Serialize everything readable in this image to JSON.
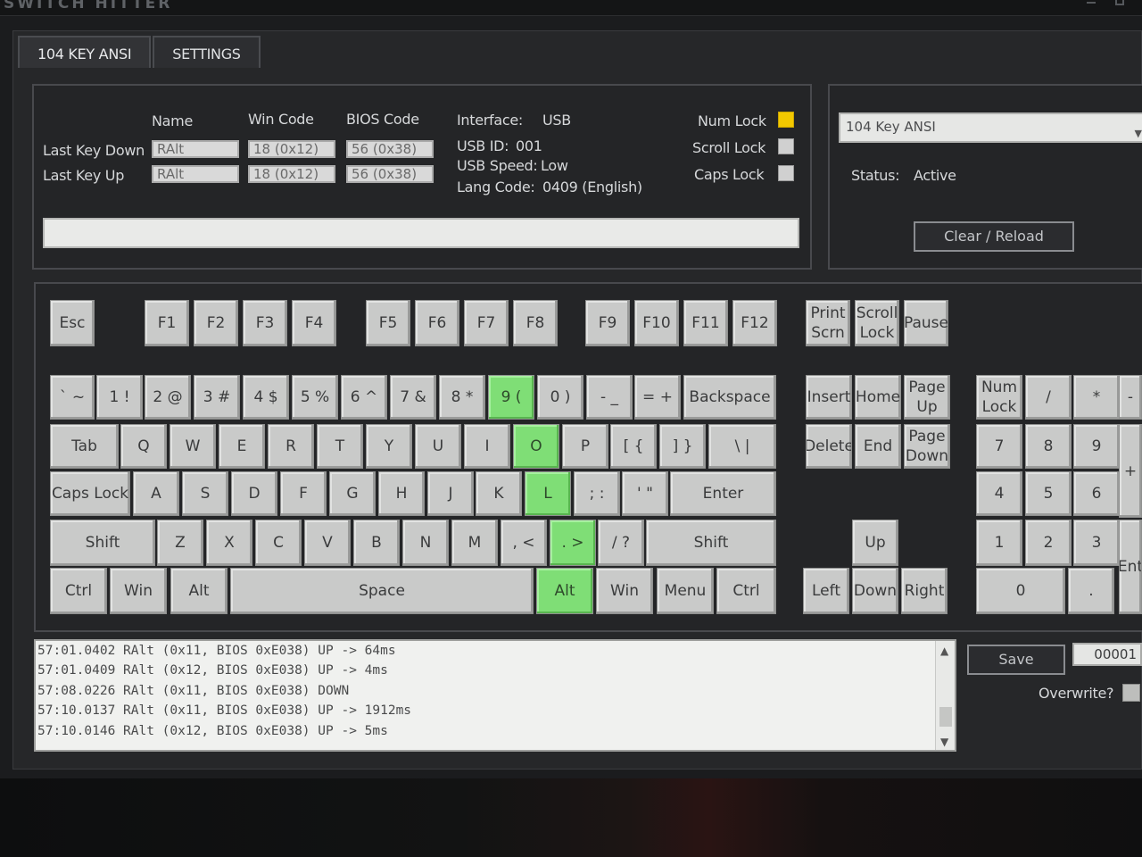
{
  "app": {
    "title": "SWITCH HITTER"
  },
  "tabs": [
    {
      "label": "104 KEY ANSI"
    },
    {
      "label": "SETTINGS"
    }
  ],
  "info": {
    "col_name": "Name",
    "col_win": "Win Code",
    "col_bios": "BIOS Code",
    "last_key_down": {
      "label": "Last Key Down",
      "name": "RAlt",
      "win": "18 (0x12)",
      "bios": "56 (0x38)"
    },
    "last_key_up": {
      "label": "Last Key Up",
      "name": "RAlt",
      "win": "18 (0x12)",
      "bios": "56 (0x38)"
    },
    "interface_label": "Interface:",
    "interface_value": "USB",
    "usb_id_label": "USB ID:",
    "usb_id_value": "001",
    "usb_speed_label": "USB Speed:",
    "usb_speed_value": "Low",
    "lang_label": "Lang Code:",
    "lang_value": "0409 (English)",
    "locks": [
      {
        "label": "Num Lock",
        "on": true
      },
      {
        "label": "Scroll Lock",
        "on": false
      },
      {
        "label": "Caps Lock",
        "on": false
      }
    ],
    "indicator_on_color": "#f2c800"
  },
  "right": {
    "layout_selected": "104 Key ANSI",
    "status_label": "Status:",
    "status_value": "Active",
    "clear_button": "Clear / Reload"
  },
  "keyboard": {
    "pressed_color": "#7fde76",
    "keys": [
      {
        "label": "Esc",
        "pressed": false
      },
      {
        "label": "F1",
        "pressed": false
      },
      {
        "label": "F2",
        "pressed": false
      },
      {
        "label": "F3",
        "pressed": false
      },
      {
        "label": "F4",
        "pressed": false
      },
      {
        "label": "F5",
        "pressed": false
      },
      {
        "label": "F6",
        "pressed": false
      },
      {
        "label": "F7",
        "pressed": false
      },
      {
        "label": "F8",
        "pressed": false
      },
      {
        "label": "F9",
        "pressed": false
      },
      {
        "label": "F10",
        "pressed": false
      },
      {
        "label": "F11",
        "pressed": false
      },
      {
        "label": "F12",
        "pressed": false
      },
      {
        "label": "Print\nScrn",
        "pressed": false
      },
      {
        "label": "Scroll\nLock",
        "pressed": false
      },
      {
        "label": "Pause",
        "pressed": false
      },
      {
        "label": "` ~",
        "pressed": false
      },
      {
        "label": "1 !",
        "pressed": false
      },
      {
        "label": "2 @",
        "pressed": false
      },
      {
        "label": "3 #",
        "pressed": false
      },
      {
        "label": "4 $",
        "pressed": false
      },
      {
        "label": "5 %",
        "pressed": false
      },
      {
        "label": "6 ^",
        "pressed": false
      },
      {
        "label": "7 &",
        "pressed": false
      },
      {
        "label": "8 *",
        "pressed": false
      },
      {
        "label": "9 (",
        "pressed": true
      },
      {
        "label": "0 )",
        "pressed": false
      },
      {
        "label": "- _",
        "pressed": false
      },
      {
        "label": "= +",
        "pressed": false
      },
      {
        "label": "Backspace",
        "pressed": false
      },
      {
        "label": "Insert",
        "pressed": false
      },
      {
        "label": "Home",
        "pressed": false
      },
      {
        "label": "Page\nUp",
        "pressed": false
      },
      {
        "label": "Num\nLock",
        "pressed": false
      },
      {
        "label": "/",
        "pressed": false
      },
      {
        "label": "*",
        "pressed": false
      },
      {
        "label": "Tab",
        "pressed": false
      },
      {
        "label": "Q",
        "pressed": false
      },
      {
        "label": "W",
        "pressed": false
      },
      {
        "label": "E",
        "pressed": false
      },
      {
        "label": "R",
        "pressed": false
      },
      {
        "label": "T",
        "pressed": false
      },
      {
        "label": "Y",
        "pressed": false
      },
      {
        "label": "U",
        "pressed": false
      },
      {
        "label": "I",
        "pressed": false
      },
      {
        "label": "O",
        "pressed": true
      },
      {
        "label": "P",
        "pressed": false
      },
      {
        "label": "[ {",
        "pressed": false
      },
      {
        "label": "] }",
        "pressed": false
      },
      {
        "label": "\\ |",
        "pressed": false
      },
      {
        "label": "Delete",
        "pressed": false
      },
      {
        "label": "End",
        "pressed": false
      },
      {
        "label": "Page\nDown",
        "pressed": false
      },
      {
        "label": "7",
        "pressed": false
      },
      {
        "label": "8",
        "pressed": false
      },
      {
        "label": "9",
        "pressed": false
      },
      {
        "label": "Caps Lock",
        "pressed": false
      },
      {
        "label": "A",
        "pressed": false
      },
      {
        "label": "S",
        "pressed": false
      },
      {
        "label": "D",
        "pressed": false
      },
      {
        "label": "F",
        "pressed": false
      },
      {
        "label": "G",
        "pressed": false
      },
      {
        "label": "H",
        "pressed": false
      },
      {
        "label": "J",
        "pressed": false
      },
      {
        "label": "K",
        "pressed": false
      },
      {
        "label": "L",
        "pressed": true
      },
      {
        "label": "; :",
        "pressed": false
      },
      {
        "label": "' \"",
        "pressed": false
      },
      {
        "label": "Enter",
        "pressed": false
      },
      {
        "label": "4",
        "pressed": false
      },
      {
        "label": "5",
        "pressed": false
      },
      {
        "label": "6",
        "pressed": false
      },
      {
        "label": "Shift",
        "pressed": false
      },
      {
        "label": "Z",
        "pressed": false
      },
      {
        "label": "X",
        "pressed": false
      },
      {
        "label": "C",
        "pressed": false
      },
      {
        "label": "V",
        "pressed": false
      },
      {
        "label": "B",
        "pressed": false
      },
      {
        "label": "N",
        "pressed": false
      },
      {
        "label": "M",
        "pressed": false
      },
      {
        "label": ", <",
        "pressed": false
      },
      {
        "label": ". >",
        "pressed": true
      },
      {
        "label": "/ ?",
        "pressed": false
      },
      {
        "label": "Shift",
        "pressed": false
      },
      {
        "label": "Up",
        "pressed": false
      },
      {
        "label": "1",
        "pressed": false
      },
      {
        "label": "2",
        "pressed": false
      },
      {
        "label": "3",
        "pressed": false
      },
      {
        "label": "Ctrl",
        "pressed": false
      },
      {
        "label": "Win",
        "pressed": false
      },
      {
        "label": "Alt",
        "pressed": false
      },
      {
        "label": "Space",
        "pressed": false
      },
      {
        "label": "Alt",
        "pressed": true
      },
      {
        "label": "Win",
        "pressed": false
      },
      {
        "label": "Menu",
        "pressed": false
      },
      {
        "label": "Ctrl",
        "pressed": false
      },
      {
        "label": "Left",
        "pressed": false
      },
      {
        "label": "Down",
        "pressed": false
      },
      {
        "label": "Right",
        "pressed": false
      },
      {
        "label": "0",
        "pressed": false
      },
      {
        "label": ".",
        "pressed": false
      },
      {
        "label": "-",
        "pressed": false
      },
      {
        "label": "+",
        "pressed": false
      },
      {
        "label": "Ent",
        "pressed": false
      }
    ]
  },
  "log": {
    "lines": [
      "57:01.0402 RAlt (0x11, BIOS 0xE038) UP -> 64ms",
      "57:01.0409 RAlt (0x12, BIOS 0xE038) UP -> 4ms",
      "57:08.0226 RAlt (0x11, BIOS 0xE038) DOWN",
      "57:10.0137 RAlt (0x11, BIOS 0xE038) UP -> 1912ms",
      "57:10.0146 RAlt (0x12, BIOS 0xE038) UP -> 5ms"
    ]
  },
  "save_label": "Save",
  "counter_value": "00001",
  "overwrite_label": "Overwrite?"
}
